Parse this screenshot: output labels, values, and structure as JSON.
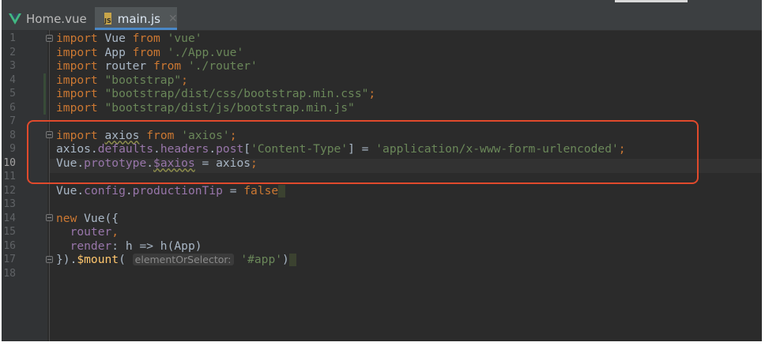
{
  "tabs": [
    {
      "label": "Home.vue",
      "icon": "vue-icon",
      "active": false
    },
    {
      "label": "main.js",
      "icon": "js-file-icon",
      "active": true
    }
  ],
  "gutter": {
    "line_numbers": [
      "1",
      "2",
      "3",
      "4",
      "5",
      "6",
      "7",
      "8",
      "9",
      "10",
      "11",
      "12",
      "13",
      "14",
      "15",
      "16",
      "17",
      "18"
    ],
    "current_line": "10"
  },
  "code": {
    "l1": {
      "kw1": "import",
      "t1": " Vue ",
      "kw2": "from",
      "t2": " ",
      "s1": "'vue'"
    },
    "l2": {
      "kw1": "import",
      "t1": " App ",
      "kw2": "from",
      "t2": " ",
      "s1": "'./App.vue'"
    },
    "l3": {
      "kw1": "import",
      "t1": " router ",
      "kw2": "from",
      "t2": " ",
      "s1": "'./router'"
    },
    "l4": {
      "kw1": "import",
      "t1": " ",
      "s1": "\"bootstrap\"",
      "end": ";"
    },
    "l5": {
      "kw1": "import",
      "t1": " ",
      "s1": "\"bootstrap/dist/css/bootstrap.min.css\"",
      "end": ";"
    },
    "l6": {
      "kw1": "import",
      "t1": " ",
      "s1": "\"bootstrap/dist/js/bootstrap.min.js\""
    },
    "l8": {
      "kw1": "import",
      "t1": " ",
      "id": "axios",
      "t2": " ",
      "kw2": "from",
      "t3": " ",
      "s1": "'axios'",
      "end": ";"
    },
    "l9": {
      "a": "axios.",
      "p1": "defaults",
      "d1": ".",
      "p2": "headers",
      "d2": ".",
      "p3": "post",
      "b1": "[",
      "s1": "'Content-Type'",
      "b2": "] = ",
      "s2": "'application/x-www-form-urlencoded'",
      "end": ";"
    },
    "l10": {
      "a": "Vue.",
      "p1": "prototype",
      "d1": ".",
      "p2": "$axios",
      "t1": " = axios",
      "end": ";"
    },
    "l12": {
      "a": "Vue.",
      "p1": "config",
      "d1": ".",
      "p2": "productionTip",
      "t1": " = ",
      "kw1": "false"
    },
    "l14": {
      "kw1": "new",
      "t1": " Vue({"
    },
    "l15": {
      "t1": "  ",
      "p1": "router",
      "end": ","
    },
    "l16": {
      "t1": "  ",
      "p1": "render",
      "t2": ": h => h(App)"
    },
    "l17": {
      "t1": "}).",
      "fn": "$mount",
      "t2": "( ",
      "hint": "elementOrSelector:",
      "t3": " ",
      "s1": "'#app'",
      "t4": ")"
    }
  },
  "colors": {
    "background": "#2b2b2b",
    "keyword": "#cc7832",
    "string": "#6a8759",
    "property": "#9876aa",
    "function": "#ffc66d",
    "annotation_box": "#e04a2c"
  }
}
